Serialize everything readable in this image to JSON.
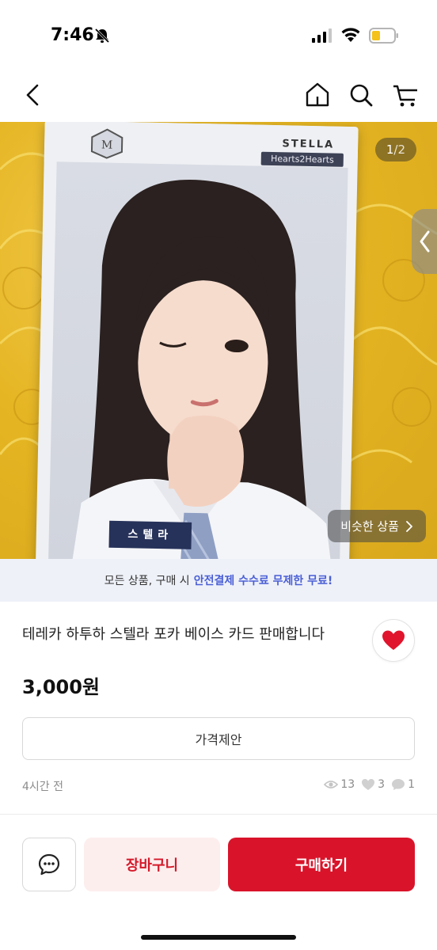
{
  "status_bar": {
    "time": "7:46"
  },
  "photo": {
    "counter_current": "1",
    "counter_total": "/2",
    "similar_label": "비슷한 상품",
    "card": {
      "name": "STELLA",
      "group": "Hearts2Hearts",
      "nametag": "스텔라"
    }
  },
  "banner": {
    "text": "모든 상품, 구매 시",
    "highlight": "안전결제 수수료 무제한 무료!"
  },
  "product": {
    "title": "테레카 하투하 스텔라 포카 베이스 카드 판매합니다",
    "price": "3,000원"
  },
  "actions": {
    "offer_label": "가격제안",
    "cart_label": "장바구니",
    "buy_label": "구매하기"
  },
  "meta": {
    "posted": "4시간 전",
    "views": "13",
    "likes": "3",
    "chats": "1"
  },
  "colors": {
    "accent_red": "#d9142a",
    "banner_highlight": "#4a5fd6",
    "heart": "#e0142c"
  }
}
